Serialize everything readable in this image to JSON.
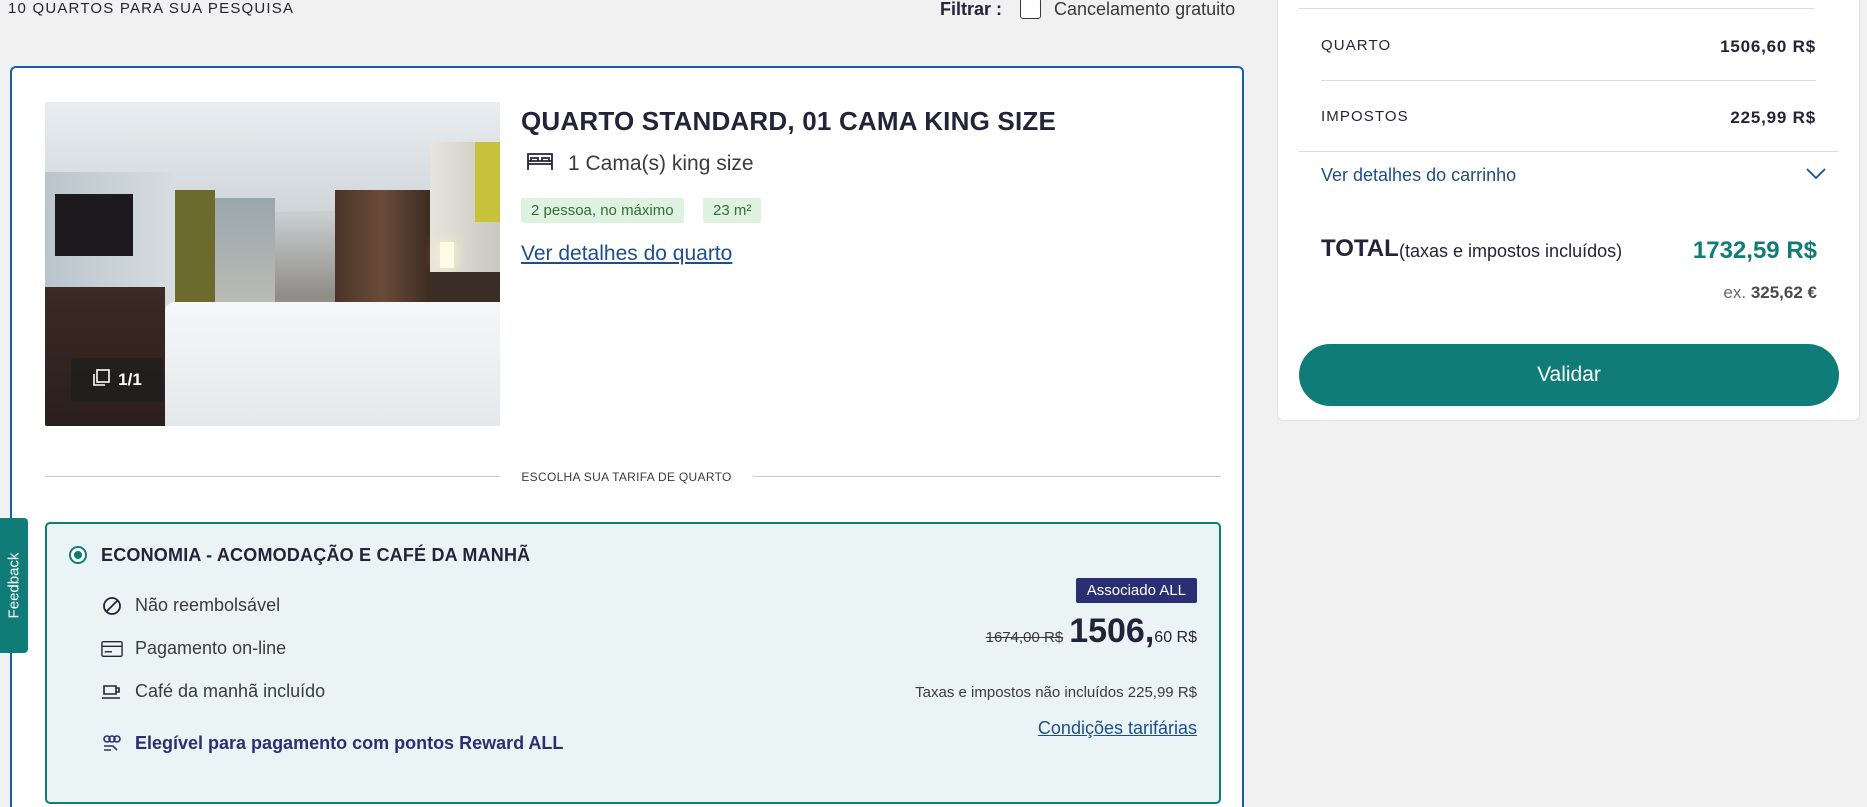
{
  "topbar": {
    "result_count": "10 QUARTOS PARA SUA PESQUISA",
    "filter_label": "Filtrar :",
    "filter_option": "Cancelamento gratuito"
  },
  "room": {
    "photo_counter": "1/1",
    "title": "QUARTO STANDARD, 01 CAMA KING SIZE",
    "bed": "1 Cama(s) king size",
    "tags": [
      "2 pessoa, no máximo",
      "23 m²"
    ],
    "details_link": "Ver detalhes do quarto",
    "rate_divider": "ESCOLHA SUA TARIFA DE QUARTO"
  },
  "rate": {
    "title": "ECONOMIA - ACOMODAÇÃO E CAFÉ DA MANHÃ",
    "features": [
      {
        "icon": "no-refund-icon",
        "label": "Não reembolsável"
      },
      {
        "icon": "credit-card-icon",
        "label": "Pagamento on-line"
      },
      {
        "icon": "breakfast-cup-icon",
        "label": "Café da manhã incluído"
      },
      {
        "icon": "reward-points-icon",
        "label": "Elegível para pagamento com pontos Reward ALL"
      }
    ],
    "member_badge": "Associado ALL",
    "old_price": "1674,00 R$",
    "new_price_int": "1506,",
    "new_price_cents": "60 R$",
    "taxes_note": "Taxas e impostos não incluídos 225,99 R$",
    "conditions_link": "Condições tarifárias"
  },
  "feedback": {
    "label": "Feedback"
  },
  "summary": {
    "room_label": "QUARTO",
    "room_amount": "1506,60 R$",
    "tax_label": "IMPOSTOS",
    "tax_amount": "225,99 R$",
    "cart_link": "Ver detalhes do carrinho",
    "total_label": "TOTAL",
    "total_sub": "(taxas e impostos incluídos)",
    "total_amount": "1732,59 R$",
    "ex_prefix": "ex.",
    "ex_amount": "325,62 €",
    "validate_label": "Validar"
  },
  "colors": {
    "accent": "#107c78",
    "link": "#1d4e8c",
    "member": "#2a2f73",
    "card_border": "#1a5ea6"
  }
}
